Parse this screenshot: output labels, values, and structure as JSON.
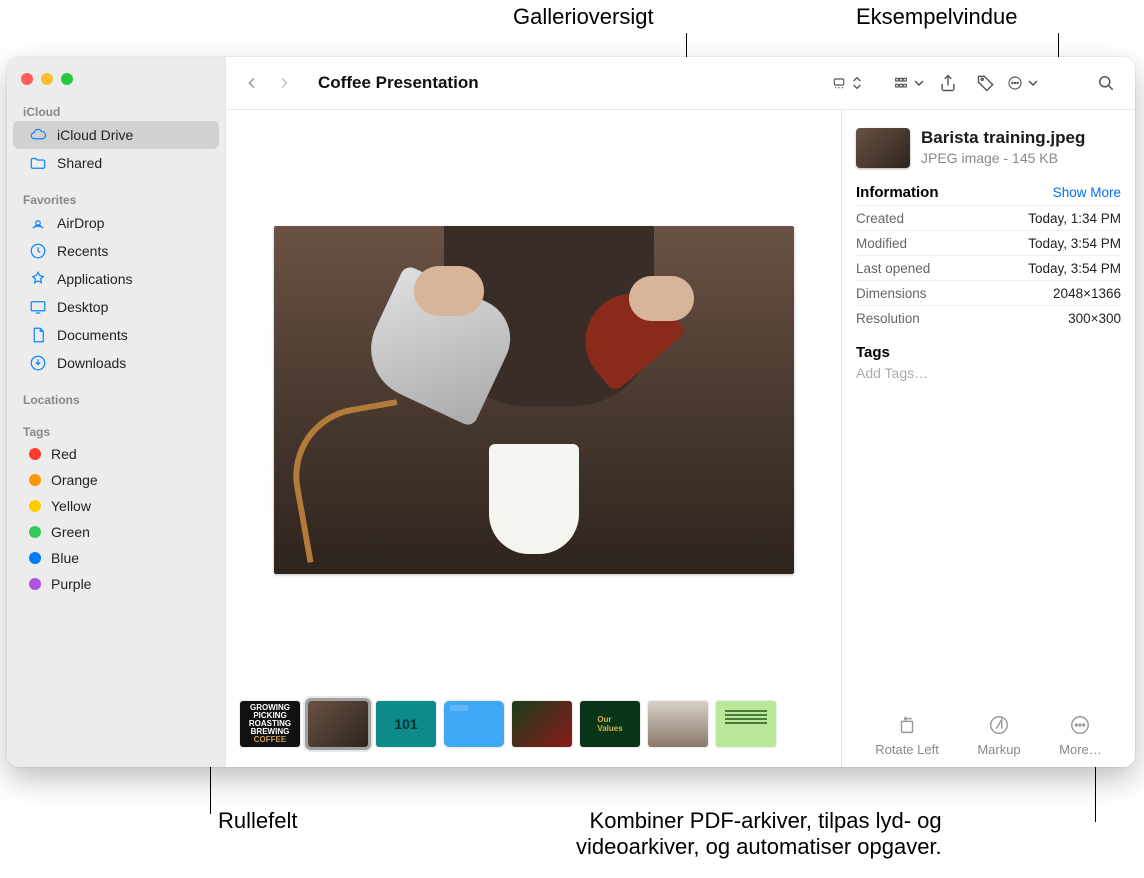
{
  "callouts": {
    "gallery_overview": "Gallerioversigt",
    "preview_pane": "Eksempelvindue",
    "scroll_strip": "Rullefelt",
    "more_actions_caption_line1": "Kombiner PDF-arkiver, tilpas lyd- og",
    "more_actions_caption_line2": "videoarkiver, og automatiser opgaver."
  },
  "window": {
    "title": "Coffee Presentation"
  },
  "sidebar": {
    "sections": {
      "icloud": "iCloud",
      "favorites": "Favorites",
      "locations": "Locations",
      "tags": "Tags"
    },
    "icloud_items": [
      {
        "label": "iCloud Drive",
        "icon": "cloud-icon",
        "selected": true
      },
      {
        "label": "Shared",
        "icon": "shared-folder-icon",
        "selected": false
      }
    ],
    "favorites": [
      {
        "label": "AirDrop",
        "icon": "airdrop-icon"
      },
      {
        "label": "Recents",
        "icon": "clock-icon"
      },
      {
        "label": "Applications",
        "icon": "apps-icon"
      },
      {
        "label": "Desktop",
        "icon": "desktop-icon"
      },
      {
        "label": "Documents",
        "icon": "documents-icon"
      },
      {
        "label": "Downloads",
        "icon": "downloads-icon"
      }
    ],
    "tags": [
      {
        "label": "Red",
        "color": "#ff3b30"
      },
      {
        "label": "Orange",
        "color": "#ff9500"
      },
      {
        "label": "Yellow",
        "color": "#ffcc00"
      },
      {
        "label": "Green",
        "color": "#34c759"
      },
      {
        "label": "Blue",
        "color": "#007aff"
      },
      {
        "label": "Purple",
        "color": "#af52de"
      }
    ]
  },
  "thumbnails": [
    {
      "name": "growing-picking-roasting-brewing-coffee"
    },
    {
      "name": "barista-training",
      "selected": true
    },
    {
      "name": "coffee-101"
    },
    {
      "name": "folder"
    },
    {
      "name": "cherries"
    },
    {
      "name": "our-values"
    },
    {
      "name": "people-meeting"
    },
    {
      "name": "document-green"
    }
  ],
  "info": {
    "filename": "Barista training.jpeg",
    "kind_and_size": "JPEG image - 145 KB",
    "section_title": "Information",
    "show_more": "Show More",
    "rows": [
      {
        "key": "Created",
        "val": "Today, 1:34 PM"
      },
      {
        "key": "Modified",
        "val": "Today, 3:54 PM"
      },
      {
        "key": "Last opened",
        "val": "Today, 3:54 PM"
      },
      {
        "key": "Dimensions",
        "val": "2048×1366"
      },
      {
        "key": "Resolution",
        "val": "300×300"
      }
    ],
    "tags_title": "Tags",
    "add_tags_placeholder": "Add Tags…"
  },
  "actions": {
    "rotate": "Rotate Left",
    "markup": "Markup",
    "more": "More…"
  }
}
